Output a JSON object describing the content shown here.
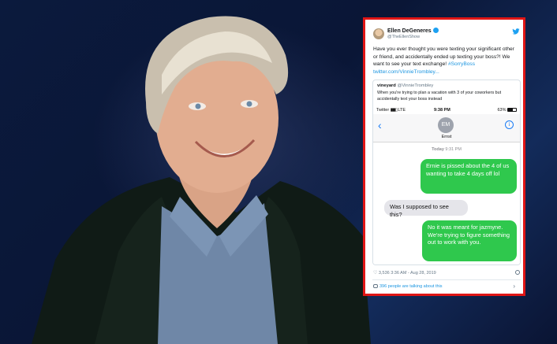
{
  "tweet": {
    "author_name": "Ellen DeGeneres",
    "author_handle": "@TheEllenShow",
    "body_text": "Have you ever thought you were texting your significant other or friend, and accidentally ended up texting your boss?! We want to see your text exchange! ",
    "hashtag": "#SorryBoss",
    "link": "twitter.com/VinnieTrombley...",
    "quoted": {
      "author_name": "vineyard",
      "author_handle": "@VinnieTrombley",
      "text": "When you're trying to plan a vacation with 3 of your coworkers but accidentally text your boss instead",
      "phone": {
        "status_left": "Twitter",
        "signal": "LTE",
        "time": "9:38 PM",
        "battery": "63%",
        "contact_initials": "EM",
        "contact_name": "Ernst",
        "timestamp_day": "Today",
        "timestamp_time": "9:31 PM",
        "messages": [
          {
            "type": "sent",
            "text": "Ernie is pissed about the 4 of us wanting to take 4 days off lol"
          },
          {
            "type": "received",
            "text": "Was I supposed to see this?"
          },
          {
            "type": "sent",
            "text": "No it was meant for jazmyne. We're trying to figure something out to work with you."
          }
        ]
      }
    },
    "likes": "3,536",
    "posted": "3:36 AM - Aug 28, 2019",
    "talking": "396 people are talking about this"
  },
  "icons": [
    "twitter-bird-icon",
    "verified-icon",
    "back-chevron-icon",
    "info-icon",
    "heart-icon",
    "comment-icon",
    "chevron-right-icon"
  ],
  "colors": {
    "frame_border": "#e01515",
    "sent_bubble": "#2fc84d",
    "received_bubble": "#e5e5ea",
    "twitter_blue": "#1da1f2",
    "background": "#0c1a3e"
  }
}
